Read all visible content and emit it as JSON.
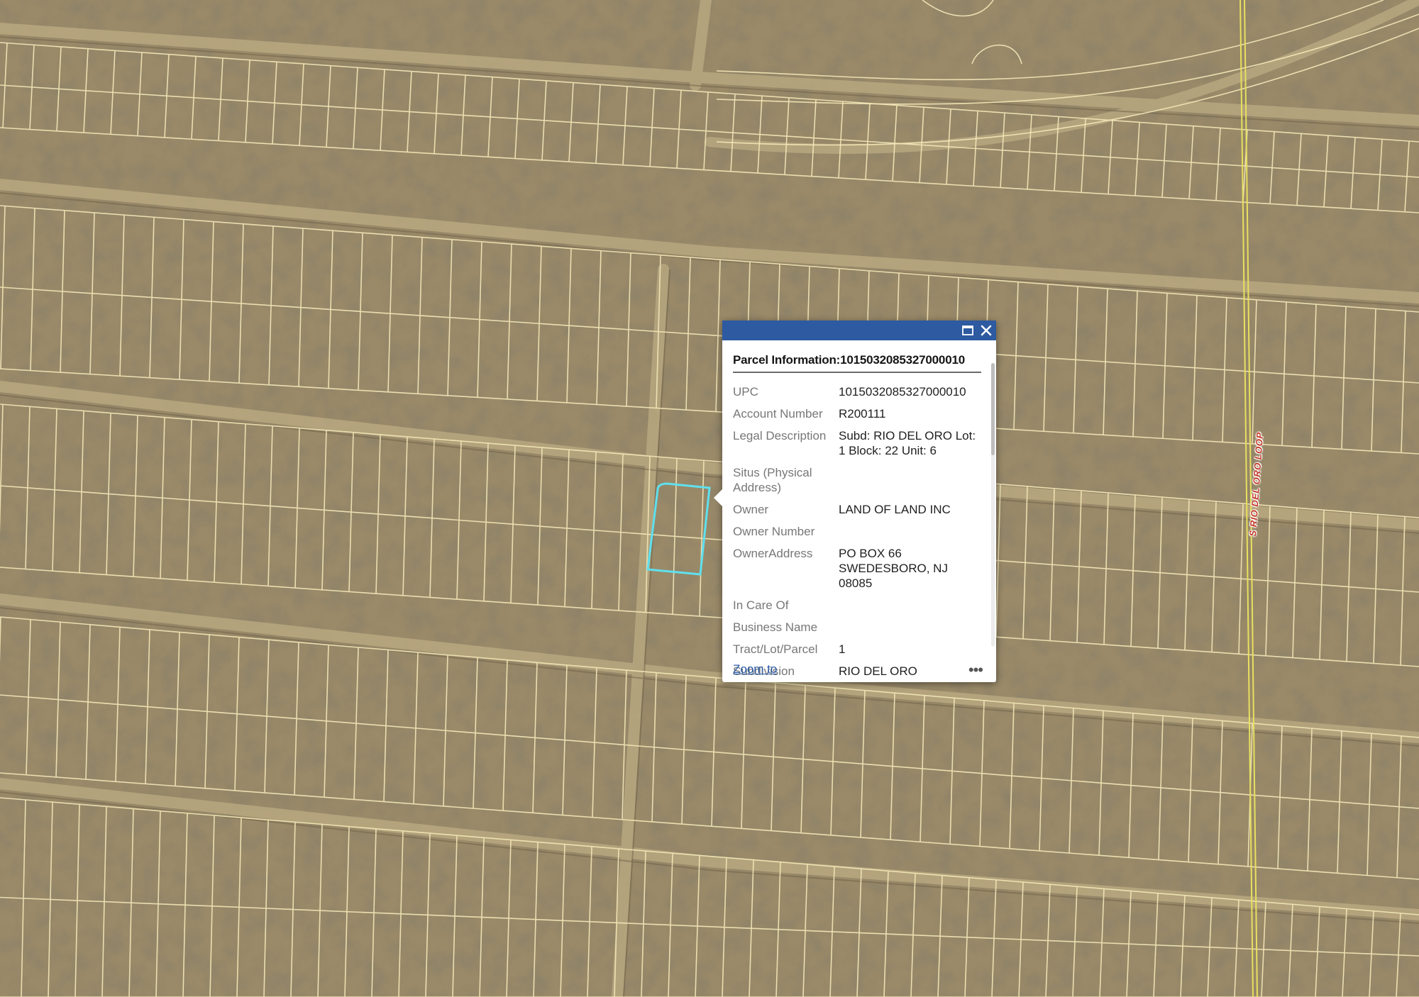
{
  "map": {
    "road_label": "S RIO DEL ORO LOOP",
    "colors": {
      "terrain": "#9c8a66",
      "parcel_line": "#f3e8b8",
      "road_dirt": "#b8a880",
      "highway_line": "#e8e060",
      "selected_parcel": "#5fe0ee"
    }
  },
  "popup": {
    "header_color": "#2d5aa0",
    "title": "Parcel Information:1015032085327000010",
    "fields": [
      {
        "key": "UPC",
        "value": "1015032085327000010"
      },
      {
        "key": "Account Number",
        "value": "R200111"
      },
      {
        "key": "Legal Description",
        "value": "Subd: RIO DEL ORO Lot: 1 Block: 22 Unit: 6"
      },
      {
        "key": "Situs (Physical Address)",
        "value": ""
      },
      {
        "key": "Owner",
        "value": "LAND OF LAND INC"
      },
      {
        "key": "Owner Number",
        "value": ""
      },
      {
        "key": "OwnerAddress",
        "value": "PO BOX 66 SWEDESBORO, NJ 08085"
      },
      {
        "key": "In Care Of",
        "value": ""
      },
      {
        "key": "Business Name",
        "value": ""
      },
      {
        "key": "Tract/Lot/Parcel",
        "value": "1"
      },
      {
        "key": "Subdivision",
        "value": "RIO DEL ORO"
      }
    ],
    "zoom_label": "Zoom to",
    "more_label": "•••"
  }
}
